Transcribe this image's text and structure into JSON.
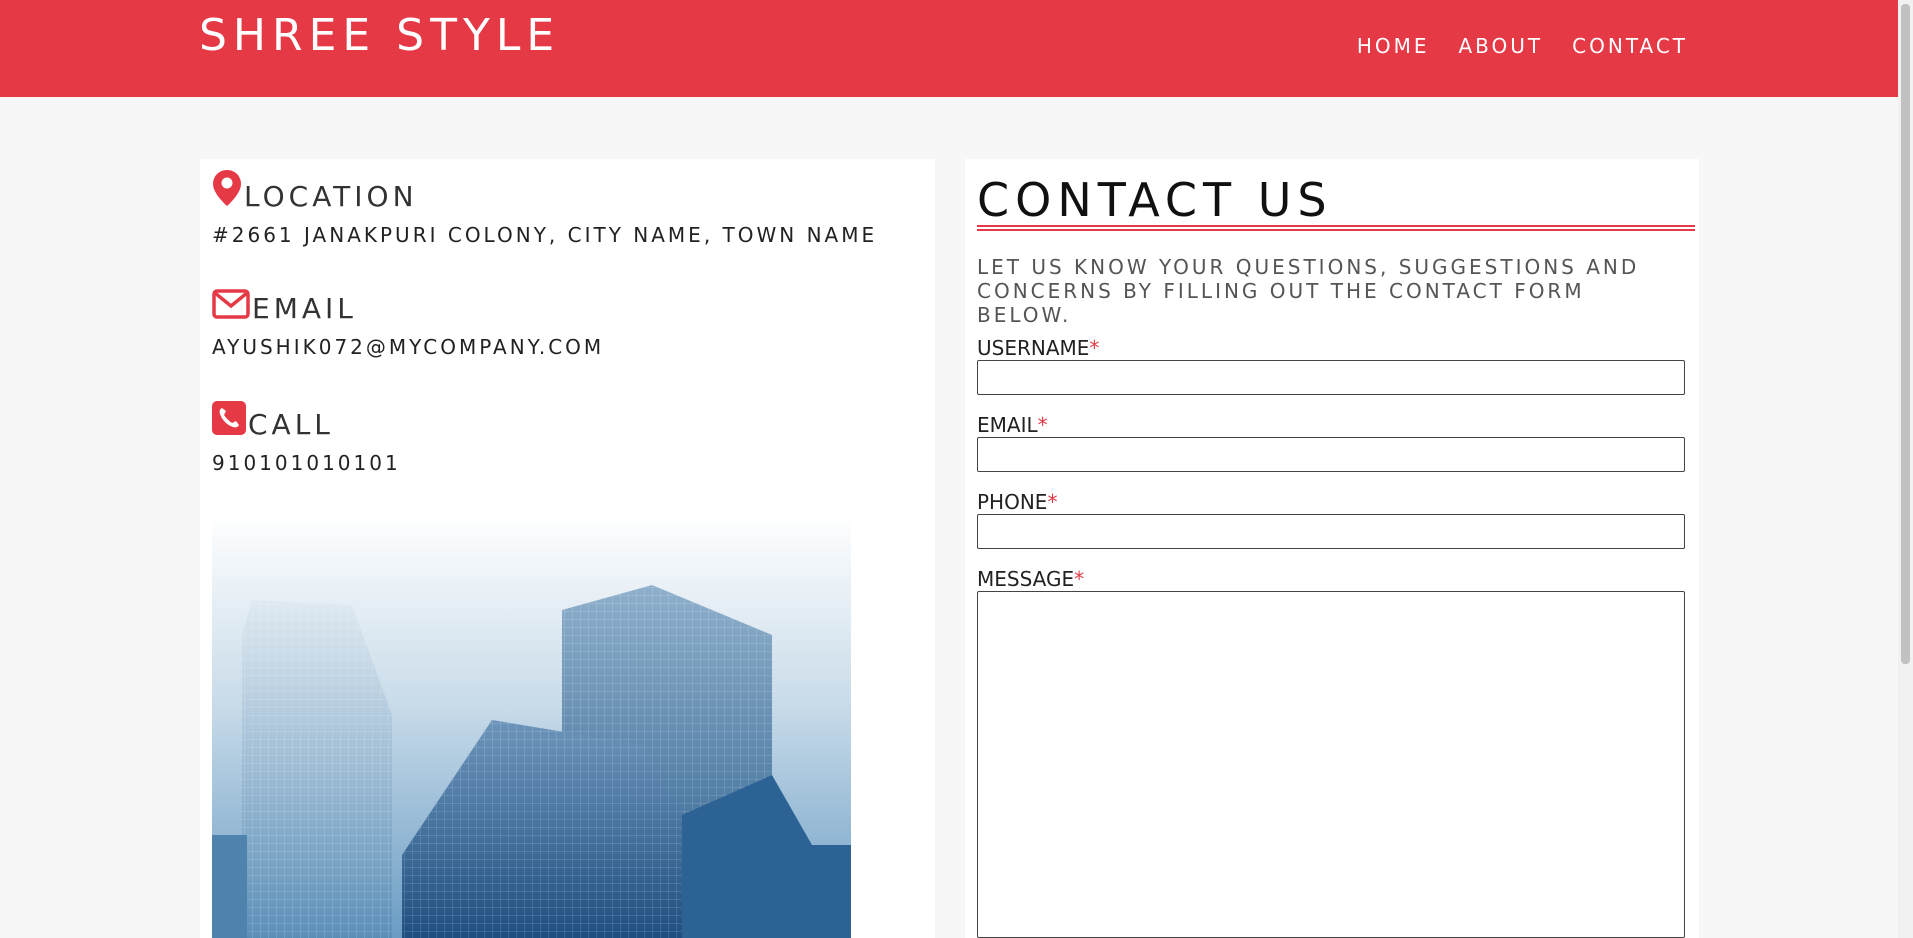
{
  "header": {
    "brand": "SHREE STYLE",
    "nav": [
      "HOME",
      "ABOUT",
      "CONTACT"
    ]
  },
  "info": {
    "location": {
      "title": "LOCATION",
      "value": "#2661 JANAKPURI COLONY, CITY NAME, TOWN NAME",
      "icon": "map-pin-icon"
    },
    "email": {
      "title": "EMAIL",
      "value": "AYUSHIK072@MYCOMPANY.COM",
      "icon": "envelope-icon"
    },
    "call": {
      "title": "CALL",
      "value": "910101010101",
      "icon": "phone-icon"
    }
  },
  "contact": {
    "title": "CONTACT US",
    "subtitle": "LET US KNOW YOUR QUESTIONS, SUGGESTIONS AND CONCERNS BY FILLING OUT THE CONTACT FORM BELOW.",
    "fields": {
      "username": "USERNAME",
      "email": "EMAIL",
      "phone": "PHONE",
      "message": "MESSAGE"
    },
    "required_mark": "*"
  },
  "colors": {
    "accent": "#e63946",
    "background": "#f7f7f7"
  }
}
